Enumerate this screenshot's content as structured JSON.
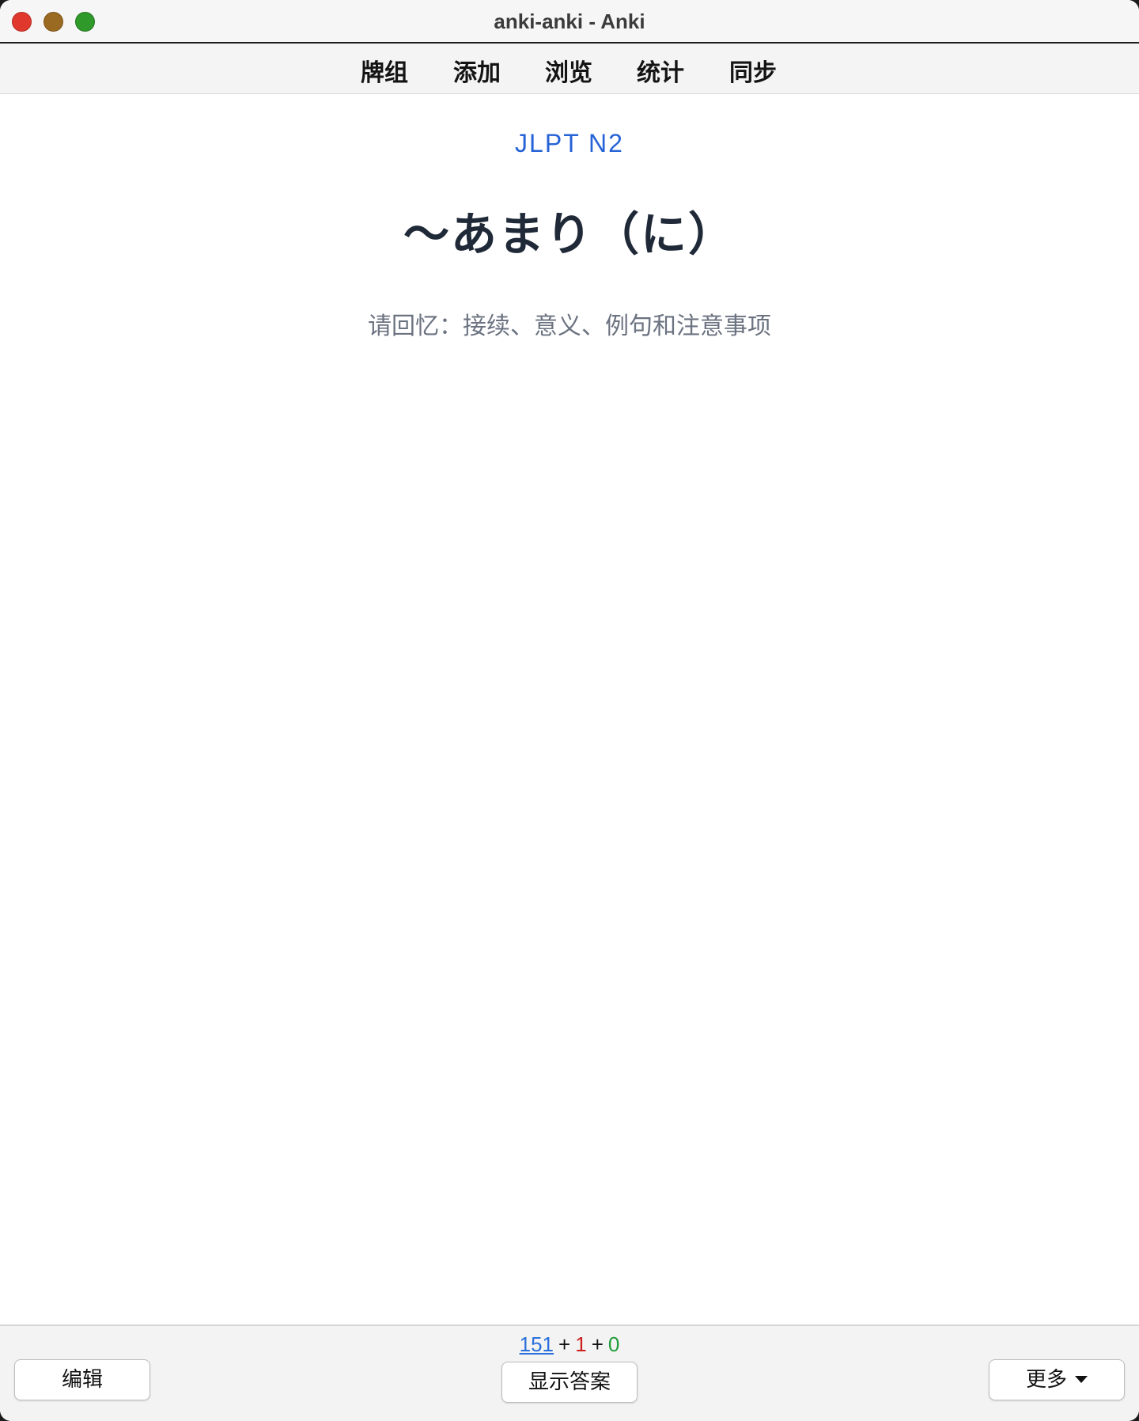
{
  "window": {
    "title": "anki-anki - Anki"
  },
  "toolbar": {
    "items": [
      {
        "label": "牌组"
      },
      {
        "label": "添加"
      },
      {
        "label": "浏览"
      },
      {
        "label": "统计"
      },
      {
        "label": "同步"
      }
    ]
  },
  "card": {
    "deck_tag": "JLPT N2",
    "headword": "〜あまり（に）",
    "prompt": "请回忆：接续、意义、例句和注意事项"
  },
  "bottom": {
    "edit_label": "编辑",
    "show_answer_label": "显示答案",
    "more_label": "更多",
    "counts": {
      "new": "151",
      "learn": "1",
      "review": "0",
      "separator": "+"
    }
  },
  "colors": {
    "accent_blue": "#2563d6",
    "new_count": "#2a6fdb",
    "learn_count": "#cc1f1f",
    "review_count": "#1f9d3a",
    "close_button": "#e0382d",
    "minimize_button": "#9b6a22",
    "maximize_button": "#2f9a2a"
  }
}
